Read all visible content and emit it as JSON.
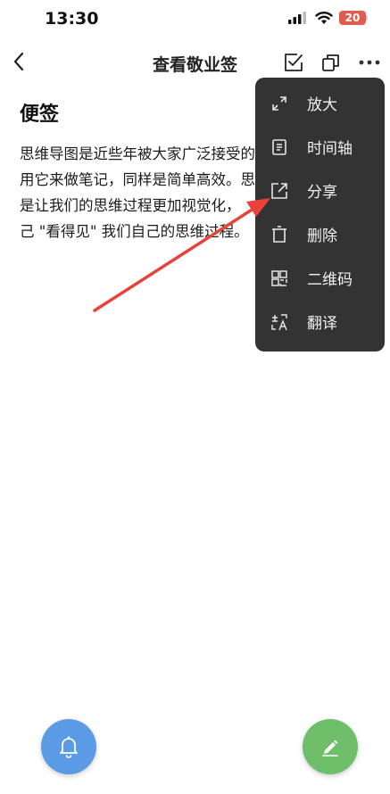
{
  "status_bar": {
    "time": "13:30",
    "battery": "20",
    "battery_color": "#e25b4f"
  },
  "nav": {
    "title": "查看敬业签"
  },
  "note": {
    "heading": "便签",
    "lines": [
      "思维导图是近些年被大家广泛接受的",
      "用它来做笔记，同样是简单高效。思",
      "是让我们的思维过程更加视觉化，",
      "己 \"看得见\" 我们自己的思维过程。"
    ]
  },
  "menu": {
    "items": [
      {
        "label": "放大",
        "icon": "expand-icon"
      },
      {
        "label": "时间轴",
        "icon": "timeline-icon"
      },
      {
        "label": "分享",
        "icon": "share-icon"
      },
      {
        "label": "删除",
        "icon": "trash-icon"
      },
      {
        "label": "二维码",
        "icon": "qrcode-icon"
      },
      {
        "label": "翻译",
        "icon": "translate-icon"
      }
    ]
  },
  "colors": {
    "menu_bg": "#333333",
    "arrow": "#e8423a",
    "bell_fab": "#5b9be6",
    "edit_fab": "#6fbf6a"
  }
}
